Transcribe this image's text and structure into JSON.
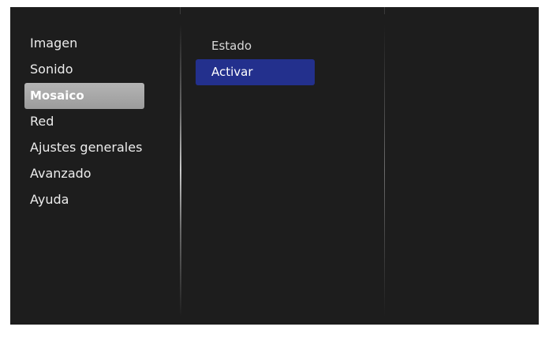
{
  "main_menu": {
    "items": [
      {
        "label": "Imagen"
      },
      {
        "label": "Sonido"
      },
      {
        "label": "Mosaico",
        "selected": true
      },
      {
        "label": "Red"
      },
      {
        "label": "Ajustes generales"
      },
      {
        "label": "Avanzado"
      },
      {
        "label": "Ayuda"
      }
    ]
  },
  "submenu": {
    "items": [
      {
        "label": "Estado"
      },
      {
        "label": "Activar",
        "highlighted": true
      }
    ]
  },
  "colors": {
    "background": "#1d1d1d",
    "selected_item": "#a9a9a9",
    "highlighted_item": "#23308d",
    "text": "#ececec"
  }
}
